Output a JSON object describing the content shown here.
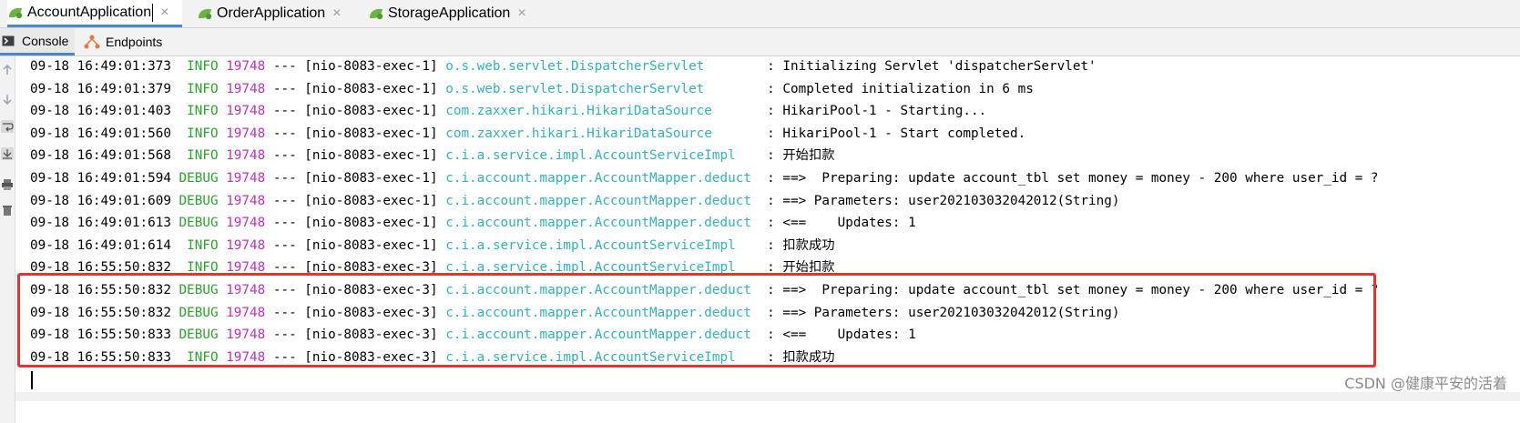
{
  "run_tabs": [
    {
      "label": "AccountApplication",
      "active": true
    },
    {
      "label": "OrderApplication",
      "active": false
    },
    {
      "label": "StorageApplication",
      "active": false
    }
  ],
  "close_glyph": "×",
  "tool_tabs": [
    {
      "label": "Console",
      "active": true
    },
    {
      "label": "Endpoints",
      "active": false
    }
  ],
  "log_lines": [
    {
      "ts": "09-18 16:49:01:373",
      "level": " INFO",
      "pid": "19748",
      "sep": "---",
      "thread": "[nio-8083-exec-1]",
      "logger": "o.s.web.servlet.DispatcherServlet       ",
      "msg": ": Initializing Servlet 'dispatcherServlet'"
    },
    {
      "ts": "09-18 16:49:01:379",
      "level": " INFO",
      "pid": "19748",
      "sep": "---",
      "thread": "[nio-8083-exec-1]",
      "logger": "o.s.web.servlet.DispatcherServlet       ",
      "msg": ": Completed initialization in 6 ms"
    },
    {
      "ts": "09-18 16:49:01:403",
      "level": " INFO",
      "pid": "19748",
      "sep": "---",
      "thread": "[nio-8083-exec-1]",
      "logger": "com.zaxxer.hikari.HikariDataSource      ",
      "msg": ": HikariPool-1 - Starting..."
    },
    {
      "ts": "09-18 16:49:01:560",
      "level": " INFO",
      "pid": "19748",
      "sep": "---",
      "thread": "[nio-8083-exec-1]",
      "logger": "com.zaxxer.hikari.HikariDataSource      ",
      "msg": ": HikariPool-1 - Start completed."
    },
    {
      "ts": "09-18 16:49:01:568",
      "level": " INFO",
      "pid": "19748",
      "sep": "---",
      "thread": "[nio-8083-exec-1]",
      "logger": "c.i.a.service.impl.AccountServiceImpl   ",
      "msg": ": 开始扣款"
    },
    {
      "ts": "09-18 16:49:01:594",
      "level": "DEBUG",
      "pid": "19748",
      "sep": "---",
      "thread": "[nio-8083-exec-1]",
      "logger": "c.i.account.mapper.AccountMapper.deduct ",
      "msg": ": ==>  Preparing: update account_tbl set money = money - 200 where user_id = ?"
    },
    {
      "ts": "09-18 16:49:01:609",
      "level": "DEBUG",
      "pid": "19748",
      "sep": "---",
      "thread": "[nio-8083-exec-1]",
      "logger": "c.i.account.mapper.AccountMapper.deduct ",
      "msg": ": ==> Parameters: user202103032042012(String)"
    },
    {
      "ts": "09-18 16:49:01:613",
      "level": "DEBUG",
      "pid": "19748",
      "sep": "---",
      "thread": "[nio-8083-exec-1]",
      "logger": "c.i.account.mapper.AccountMapper.deduct ",
      "msg": ": <==    Updates: 1"
    },
    {
      "ts": "09-18 16:49:01:614",
      "level": " INFO",
      "pid": "19748",
      "sep": "---",
      "thread": "[nio-8083-exec-1]",
      "logger": "c.i.a.service.impl.AccountServiceImpl   ",
      "msg": ": 扣款成功"
    },
    {
      "ts": "09-18 16:55:50:832",
      "level": " INFO",
      "pid": "19748",
      "sep": "---",
      "thread": "[nio-8083-exec-3]",
      "logger": "c.i.a.service.impl.AccountServiceImpl   ",
      "msg": ": 开始扣款"
    },
    {
      "ts": "09-18 16:55:50:832",
      "level": "DEBUG",
      "pid": "19748",
      "sep": "---",
      "thread": "[nio-8083-exec-3]",
      "logger": "c.i.account.mapper.AccountMapper.deduct ",
      "msg": ": ==>  Preparing: update account_tbl set money = money - 200 where user_id = ?"
    },
    {
      "ts": "09-18 16:55:50:832",
      "level": "DEBUG",
      "pid": "19748",
      "sep": "---",
      "thread": "[nio-8083-exec-3]",
      "logger": "c.i.account.mapper.AccountMapper.deduct ",
      "msg": ": ==> Parameters: user202103032042012(String)"
    },
    {
      "ts": "09-18 16:55:50:833",
      "level": "DEBUG",
      "pid": "19748",
      "sep": "---",
      "thread": "[nio-8083-exec-3]",
      "logger": "c.i.account.mapper.AccountMapper.deduct ",
      "msg": ": <==    Updates: 1"
    },
    {
      "ts": "09-18 16:55:50:833",
      "level": " INFO",
      "pid": "19748",
      "sep": "---",
      "thread": "[nio-8083-exec-3]",
      "logger": "c.i.a.service.impl.AccountServiceImpl   ",
      "msg": ": 扣款成功"
    }
  ],
  "watermark": "CSDN @健康平安的活着",
  "colors": {
    "timestamp": "#000000",
    "level": "#2aa52a",
    "pid": "#c22fc2",
    "logger": "#2fb4b9",
    "highlight_border": "#e8322b",
    "active_tab_underline": "#4a88c7"
  },
  "icons": {
    "run_tab": "spring-leaf-icon",
    "console_tab": "console-icon",
    "endpoints_tab": "endpoints-icon",
    "gutter": [
      "arrow-up-icon",
      "arrow-down-icon",
      "soft-wrap-icon",
      "scroll-to-end-icon",
      "print-icon",
      "trash-icon"
    ]
  }
}
